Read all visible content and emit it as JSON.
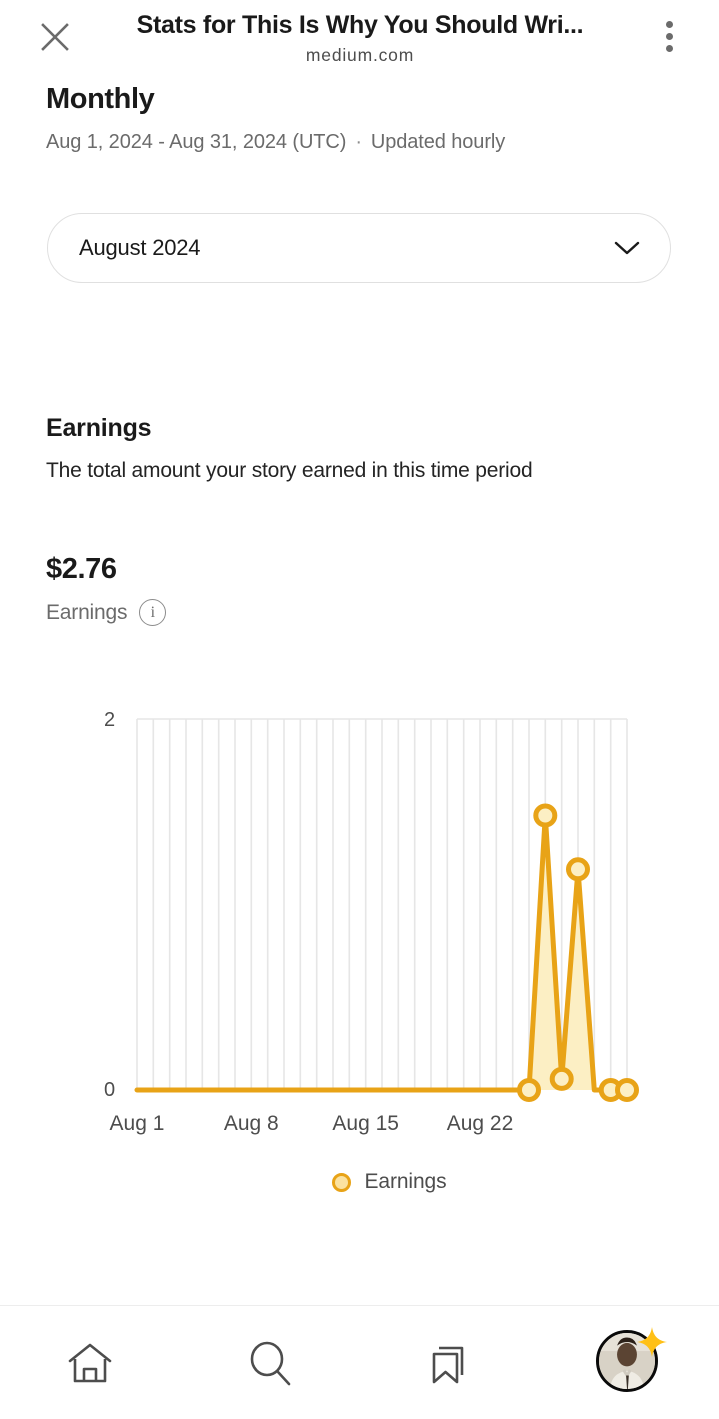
{
  "header": {
    "close_icon": "close-icon",
    "title": "Stats for This Is Why You Should Wri...",
    "subtitle": "medium.com",
    "menu_icon": "kebab-menu-icon"
  },
  "period": {
    "title": "Monthly",
    "range": "Aug 1, 2024 - Aug 31, 2024 (UTC)",
    "separator": "·",
    "updated": "Updated hourly"
  },
  "month_select": {
    "value": "August 2024",
    "chevron_icon": "chevron-down-icon"
  },
  "earnings": {
    "section_title": "Earnings",
    "description": "The total amount your story earned in this time period",
    "amount": "$2.76",
    "amount_label": "Earnings",
    "info_icon": "i"
  },
  "chart_data": {
    "type": "area",
    "title": "Earnings",
    "xlabel": "",
    "ylabel": "",
    "ylim": [
      0,
      2
    ],
    "y_ticks": [
      "0",
      "2"
    ],
    "x_tick_labels": [
      "Aug 1",
      "Aug 8",
      "Aug 15",
      "Aug 22"
    ],
    "x_tick_days": [
      1,
      8,
      15,
      22
    ],
    "grid": "vertical",
    "legend_position": "bottom-right",
    "series": [
      {
        "name": "Earnings",
        "color": "#E8A317",
        "fill": "#FCEFC4",
        "categories": [
          "Aug 1",
          "Aug 2",
          "Aug 3",
          "Aug 4",
          "Aug 5",
          "Aug 6",
          "Aug 7",
          "Aug 8",
          "Aug 9",
          "Aug 10",
          "Aug 11",
          "Aug 12",
          "Aug 13",
          "Aug 14",
          "Aug 15",
          "Aug 16",
          "Aug 17",
          "Aug 18",
          "Aug 19",
          "Aug 20",
          "Aug 21",
          "Aug 22",
          "Aug 23",
          "Aug 24",
          "Aug 25",
          "Aug 26",
          "Aug 27",
          "Aug 28",
          "Aug 29",
          "Aug 30",
          "Aug 31"
        ],
        "values": [
          0,
          0,
          0,
          0,
          0,
          0,
          0,
          0,
          0,
          0,
          0,
          0,
          0,
          0,
          0,
          0,
          0,
          0,
          0,
          0,
          0,
          0,
          0,
          0,
          0,
          1.48,
          0.06,
          1.19,
          0,
          0,
          0
        ],
        "marker_days": [
          25,
          26,
          27,
          28,
          30,
          31
        ]
      }
    ],
    "legend": [
      {
        "label": "Earnings",
        "color": "#E8A317"
      }
    ]
  },
  "bottom_nav": {
    "items": [
      {
        "name": "home-icon"
      },
      {
        "name": "search-icon"
      },
      {
        "name": "bookmark-icon"
      },
      {
        "name": "profile-avatar"
      }
    ]
  },
  "colors": {
    "accent": "#E8A317",
    "accent_fill": "#FCEFC4",
    "text_primary": "#1a1a1a",
    "text_secondary": "#6b6b6b",
    "grid": "#e6e6e6",
    "star": "#FFC017"
  }
}
